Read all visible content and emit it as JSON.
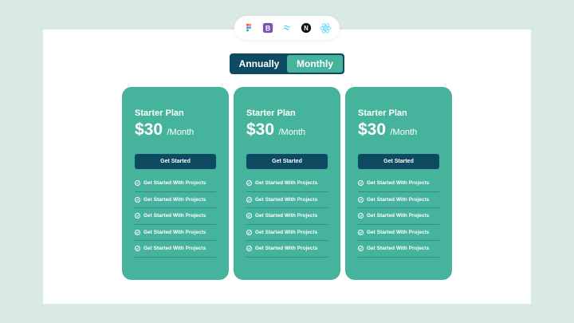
{
  "tech_icons": [
    "figma-icon",
    "bootstrap-icon",
    "tailwind-icon",
    "nextjs-icon",
    "react-icon"
  ],
  "toggle": {
    "annually_label": "Annually",
    "monthly_label": "Monthly",
    "active": "monthly"
  },
  "colors": {
    "background": "#d9e9e5",
    "card": "#46b39c",
    "dark": "#0f4a63",
    "panel": "#ffffff"
  },
  "cards": [
    {
      "plan": "Starter Plan",
      "amount": "$30",
      "period": "/Month",
      "cta": "Get Started",
      "features": [
        "Get Started With Projects",
        "Get Started With Projects",
        "Get Started With Projects",
        "Get Started With Projects",
        "Get Started With Projects"
      ]
    },
    {
      "plan": "Starter Plan",
      "amount": "$30",
      "period": "/Month",
      "cta": "Get Started",
      "features": [
        "Get Started With Projects",
        "Get Started With Projects",
        "Get Started With Projects",
        "Get Started With Projects",
        "Get Started With Projects"
      ]
    },
    {
      "plan": "Starter Plan",
      "amount": "$30",
      "period": "/Month",
      "cta": "Get Started",
      "features": [
        "Get Started With Projects",
        "Get Started With Projects",
        "Get Started With Projects",
        "Get Started With Projects",
        "Get Started With Projects"
      ]
    }
  ]
}
